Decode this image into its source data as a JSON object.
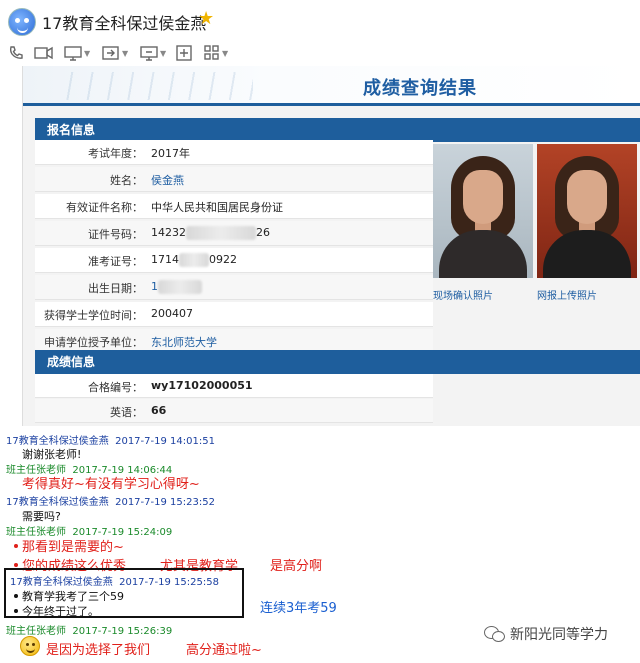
{
  "window": {
    "chat_title": "17教育全科保过侯金燕"
  },
  "toolbar": {
    "icons": [
      "phone-icon",
      "video-icon",
      "screen-share-icon",
      "file-transfer-icon",
      "remote-desktop-icon",
      "invite-icon",
      "apps-icon"
    ]
  },
  "result_page": {
    "banner_title": "成绩查询结果",
    "section_registration": "报名信息",
    "rows": [
      {
        "label": "考试年度：",
        "value": "2017年"
      },
      {
        "label": "姓名：",
        "value": "侯金燕"
      },
      {
        "label": "有效证件名称：",
        "value": "中华人民共和国居民身份证"
      },
      {
        "label": "证件号码：",
        "value_prefix": "14232",
        "value_suffix": "26"
      },
      {
        "label": "准考证号：",
        "value_prefix": "1714",
        "value_suffix": "0922"
      },
      {
        "label": "出生日期：",
        "value_prefix": "1",
        "value_suffix": ""
      },
      {
        "label": "获得学士学位时间：",
        "value": "200407"
      },
      {
        "label": "申请学位授予单位：",
        "value": "东北师范大学"
      }
    ],
    "photo_captions": [
      "现场确认照片",
      "网报上传照片"
    ],
    "section_scores": "成绩信息",
    "scores": [
      {
        "label": "合格编号：",
        "value": "wy17102000051"
      },
      {
        "label": "英语：",
        "value": "66"
      }
    ]
  },
  "chat": {
    "messages": [
      {
        "sender": "17教育全科保过侯金燕",
        "time": "2017-7-19 14:01:51",
        "text": "谢谢张老师!"
      },
      {
        "sender": "班主任张老师",
        "time": "2017-7-19 14:06:44",
        "text": "考得真好~有没有学习心得呀~"
      },
      {
        "sender": "17教育全科保过侯金燕",
        "time": "2017-7-19 15:23:52",
        "text": "需要吗?"
      },
      {
        "sender": "班主任张老师",
        "time": "2017-7-19 15:24:09",
        "text": "那看到是需要的~"
      },
      {
        "sender": "",
        "time": "",
        "text": "您的成绩这么优秀"
      },
      {
        "sender": "",
        "time": "",
        "text": "尤其是教育学"
      },
      {
        "sender": "",
        "time": "",
        "text": "是高分啊"
      },
      {
        "sender": "17教育全科保过侯金燕",
        "time": "2017-7-19 15:25:58",
        "text": "教育学我考了三个59"
      },
      {
        "sender": "",
        "time": "",
        "text": "今年终于过了。"
      },
      {
        "sender": "班主任张老师",
        "time": "2017-7-19 15:26:39",
        "text": "是因为选择了我们"
      },
      {
        "sender": "",
        "time": "",
        "text": "高分通过啦~"
      }
    ],
    "blue_note": "连续3年考59",
    "watermark": "新阳光同等学力"
  },
  "colors": {
    "accent": "#1e5e9c",
    "annotation": "#e0201a",
    "sender_student": "#1a3fa0",
    "sender_teacher": "#1a8a2a"
  }
}
